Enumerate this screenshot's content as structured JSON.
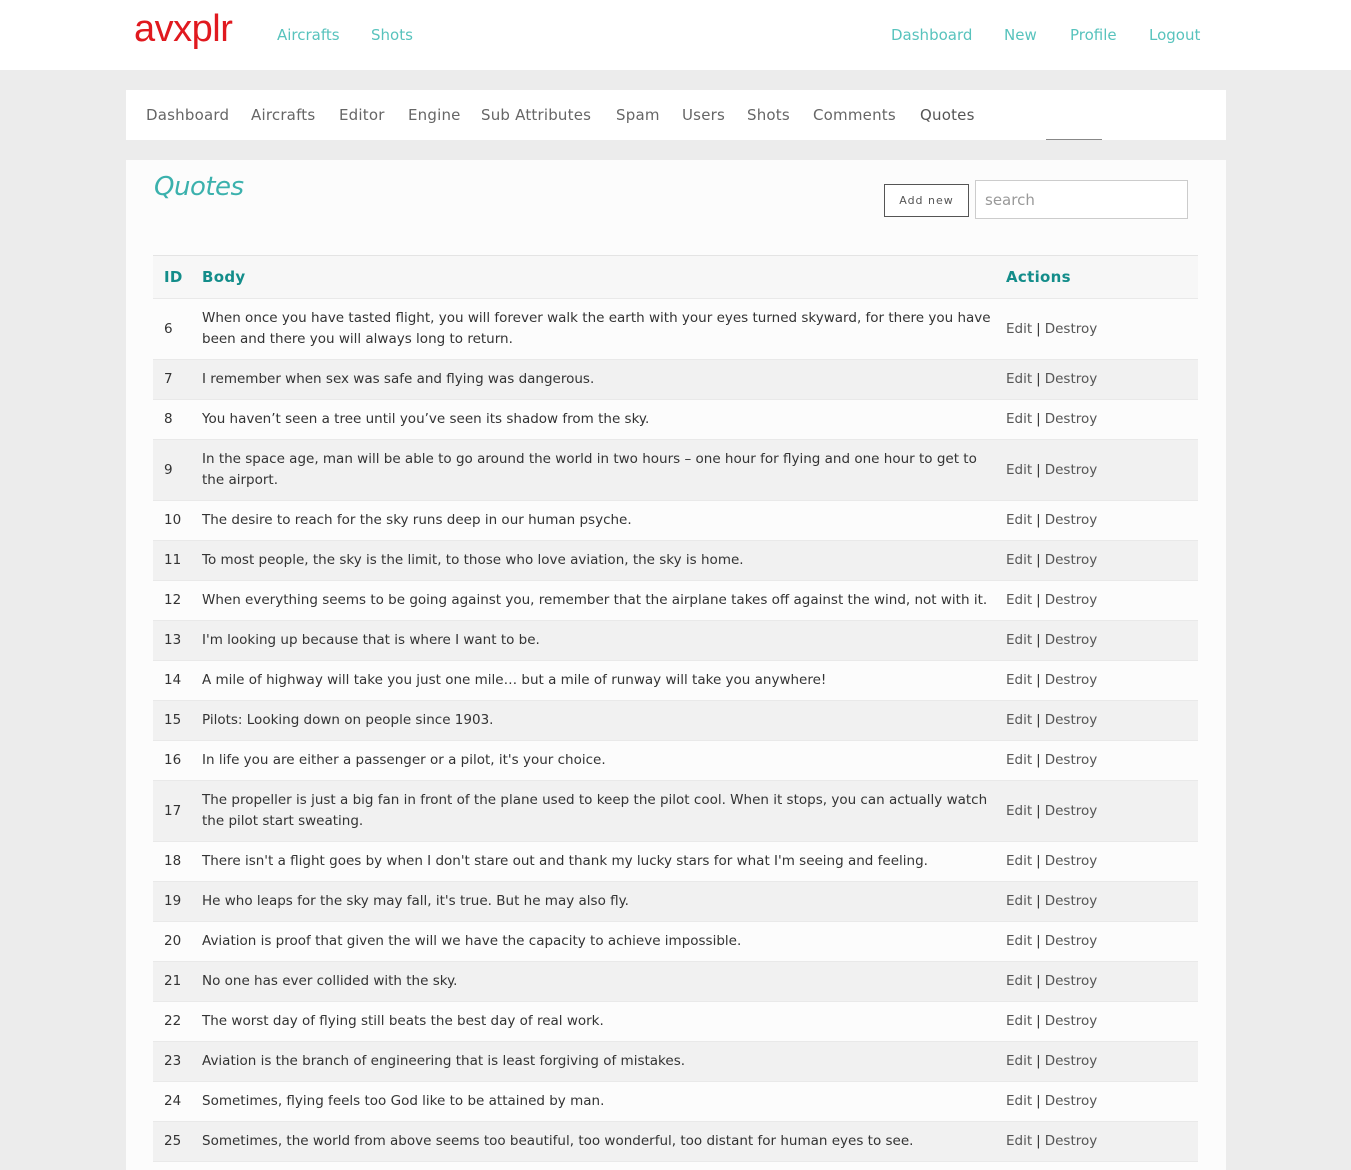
{
  "brand": {
    "logo": "avxplr"
  },
  "topnav": {
    "left": [
      {
        "label": "Aircrafts"
      },
      {
        "label": "Shots"
      }
    ],
    "right": [
      {
        "label": "Dashboard"
      },
      {
        "label": "New"
      },
      {
        "label": "Profile"
      },
      {
        "label": "Logout"
      }
    ]
  },
  "subnav": {
    "items": [
      {
        "label": "Dashboard"
      },
      {
        "label": "Aircrafts"
      },
      {
        "label": "Editor"
      },
      {
        "label": "Engine"
      },
      {
        "label": "Sub Attributes"
      },
      {
        "label": "Spam"
      },
      {
        "label": "Users"
      },
      {
        "label": "Shots"
      },
      {
        "label": "Comments"
      },
      {
        "label": "Quotes"
      }
    ],
    "active": "Quotes"
  },
  "page": {
    "title": "Quotes",
    "add_button": "Add new",
    "search_placeholder": "search"
  },
  "table": {
    "columns": {
      "id": "ID",
      "body": "Body",
      "actions": "Actions"
    },
    "edit_label": "Edit",
    "destroy_label": "Destroy",
    "rows": [
      {
        "id": "6",
        "body": "When once you have tasted flight, you will forever walk the earth with your eyes turned skyward, for there you have been and there you will always long to return."
      },
      {
        "id": "7",
        "body": "I remember when sex was safe and flying was dangerous."
      },
      {
        "id": "8",
        "body": "You haven’t seen a tree until you’ve seen its shadow from the sky."
      },
      {
        "id": "9",
        "body": "In the space age, man will be able to go around the world in two hours – one hour for flying and one hour to get to the airport."
      },
      {
        "id": "10",
        "body": "The desire to reach for the sky runs deep in our human psyche."
      },
      {
        "id": "11",
        "body": "To most people, the sky is the limit, to those who love aviation, the sky is home."
      },
      {
        "id": "12",
        "body": "When everything seems to be going against you, remember that the airplane takes off against the wind, not with it."
      },
      {
        "id": "13",
        "body": "I'm looking up because that is where I want to be."
      },
      {
        "id": "14",
        "body": "A mile of highway will take you just one mile… but a mile of runway will take you anywhere!"
      },
      {
        "id": "15",
        "body": "Pilots: Looking down on people since 1903."
      },
      {
        "id": "16",
        "body": "In life you are either a passenger or a pilot, it's your choice."
      },
      {
        "id": "17",
        "body": "The propeller is just a big fan in front of the plane used to keep the pilot cool. When it stops, you can actually watch the pilot start sweating."
      },
      {
        "id": "18",
        "body": "There isn't a flight goes by when I don't stare out and thank my lucky stars for what I'm seeing and feeling."
      },
      {
        "id": "19",
        "body": "He who leaps for the sky may fall, it's true. But he may also fly."
      },
      {
        "id": "20",
        "body": "Aviation is proof that given the will we have the capacity to achieve impossible."
      },
      {
        "id": "21",
        "body": "No one has ever collided with the sky."
      },
      {
        "id": "22",
        "body": "The worst day of flying still beats the best day of real work."
      },
      {
        "id": "23",
        "body": "Aviation is the branch of engineering that is least forgiving of mistakes."
      },
      {
        "id": "24",
        "body": "Sometimes, flying feels too God like to be attained by man."
      },
      {
        "id": "25",
        "body": "Sometimes, the world from above seems too beautiful, too wonderful, too distant for human eyes to see."
      }
    ]
  }
}
